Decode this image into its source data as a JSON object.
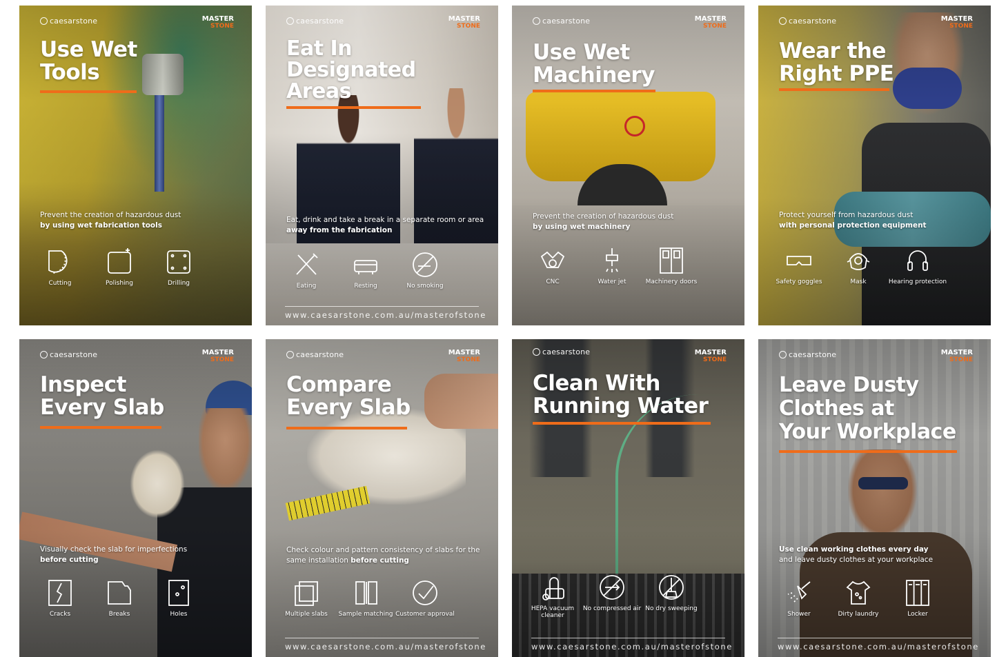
{
  "brand": "caesarstone",
  "badge": {
    "line1": "MASTER",
    "line2": "STONE"
  },
  "accent": "#ef6c1a",
  "url": "www.caesarstone.com.au/masterofstone",
  "posters": [
    {
      "title": [
        "Use Wet",
        "Tools"
      ],
      "desc_plain": "Prevent the creation of hazardous dust",
      "desc_bold": "by using wet fabrication tools",
      "icons": [
        {
          "name": "cutting-icon",
          "label": "Cutting"
        },
        {
          "name": "polishing-icon",
          "label": "Polishing"
        },
        {
          "name": "drilling-icon",
          "label": "Drilling"
        }
      ]
    },
    {
      "title": [
        "Eat In",
        "Designated",
        "Areas"
      ],
      "desc_plain": "Eat, drink and take a break in a separate room or area",
      "desc_bold": "away from the fabrication",
      "icons": [
        {
          "name": "eating-icon",
          "label": "Eating"
        },
        {
          "name": "resting-icon",
          "label": "Resting"
        },
        {
          "name": "no-smoking-icon",
          "label": "No smoking"
        }
      ],
      "has_url": true
    },
    {
      "title": [
        "Use Wet",
        "Machinery"
      ],
      "desc_plain": "Prevent the creation of hazardous dust",
      "desc_bold": "by using wet machinery",
      "icons": [
        {
          "name": "cnc-icon",
          "label": "CNC"
        },
        {
          "name": "water-jet-icon",
          "label": "Water jet"
        },
        {
          "name": "machinery-doors-icon",
          "label": "Machinery doors"
        }
      ]
    },
    {
      "title": [
        "Wear the",
        "Right PPE"
      ],
      "desc_plain": "Protect yourself from hazardous dust",
      "desc_bold": "with personal protection equipment",
      "icons": [
        {
          "name": "safety-goggles-icon",
          "label": "Safety goggles"
        },
        {
          "name": "mask-icon",
          "label": "Mask"
        },
        {
          "name": "hearing-protection-icon",
          "label": "Hearing protection"
        }
      ]
    },
    {
      "title": [
        "Inspect",
        "Every Slab"
      ],
      "desc_plain": "Visually check the slab for imperfections",
      "desc_bold": "before cutting",
      "icons": [
        {
          "name": "cracks-icon",
          "label": "Cracks"
        },
        {
          "name": "breaks-icon",
          "label": "Breaks"
        },
        {
          "name": "holes-icon",
          "label": "Holes"
        }
      ]
    },
    {
      "title": [
        "Compare",
        "Every Slab"
      ],
      "desc_plain": "Check colour and pattern consistency of slabs for the same installation",
      "desc_bold": "before cutting",
      "icons": [
        {
          "name": "multiple-slabs-icon",
          "label": "Multiple slabs"
        },
        {
          "name": "sample-matching-icon",
          "label": "Sample matching"
        },
        {
          "name": "customer-approval-icon",
          "label": "Customer approval"
        }
      ],
      "has_url": true
    },
    {
      "title": [
        "Clean With",
        "Running Water"
      ],
      "desc_plain": "",
      "desc_bold": "",
      "icons": [
        {
          "name": "hepa-vacuum-icon",
          "label": "HEPA vacuum cleaner"
        },
        {
          "name": "no-compressed-air-icon",
          "label": "No compressed air"
        },
        {
          "name": "no-dry-sweeping-icon",
          "label": "No dry sweeping"
        }
      ],
      "has_url": true
    },
    {
      "title": [
        "Leave Dusty",
        "Clothes at",
        "Your Workplace"
      ],
      "desc_bold_first": "Use clean working clothes every day",
      "desc_plain": "and leave dusty clothes at your workplace",
      "icons": [
        {
          "name": "shower-icon",
          "label": "Shower"
        },
        {
          "name": "dirty-laundry-icon",
          "label": "Dirty laundry"
        },
        {
          "name": "locker-icon",
          "label": "Locker"
        }
      ],
      "has_url": true
    }
  ]
}
